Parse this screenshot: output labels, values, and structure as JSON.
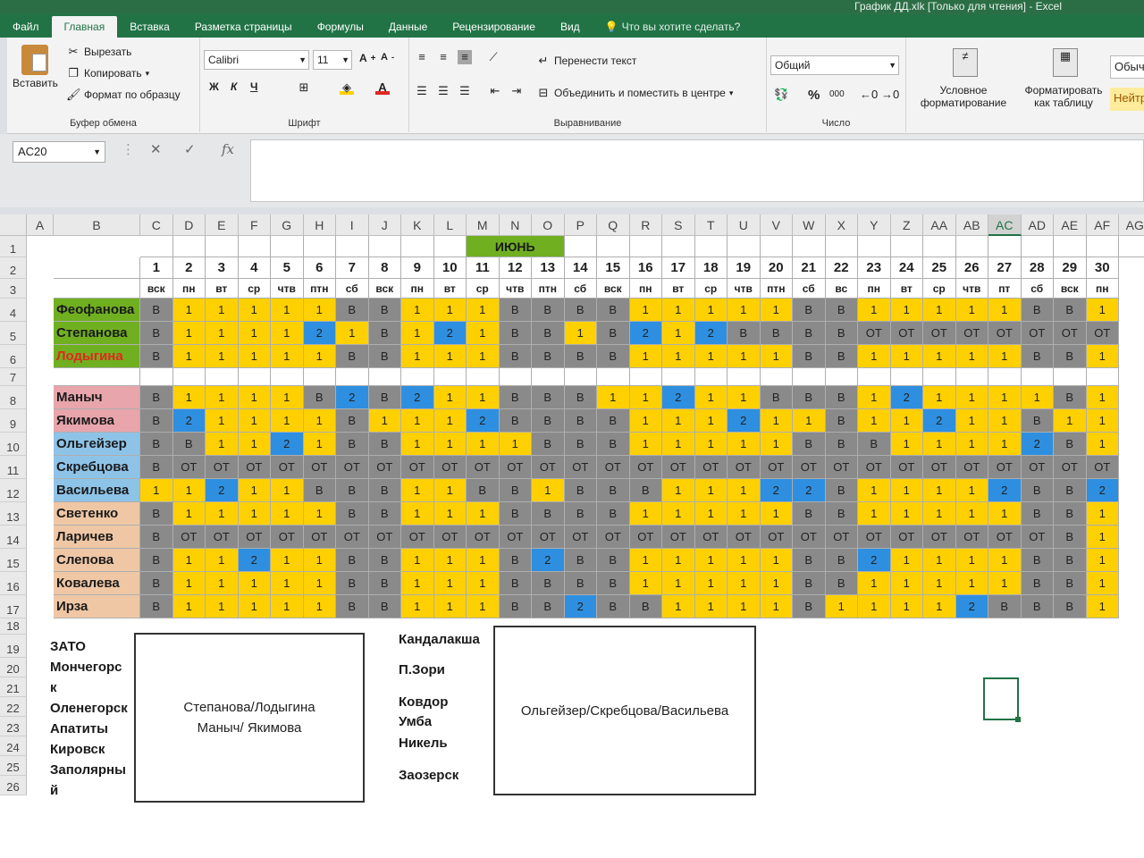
{
  "window": {
    "title": "График ДД.xlk  [Только для чтения] - Excel"
  },
  "tabs": [
    "Файл",
    "Главная",
    "Вставка",
    "Разметка страницы",
    "Формулы",
    "Данные",
    "Рецензирование",
    "Вид"
  ],
  "active_tab": "Главная",
  "tell_me": "Что вы хотите сделать?",
  "ribbon": {
    "clipboard": {
      "paste": "Вставить",
      "cut": "Вырезать",
      "copy": "Копировать",
      "format_painter": "Формат по образцу",
      "label": "Буфер обмена"
    },
    "font": {
      "name": "Calibri",
      "size": "11",
      "bold": "Ж",
      "italic": "К",
      "underline": "Ч",
      "label": "Шрифт"
    },
    "alignment": {
      "wrap": "Перенести текст",
      "merge": "Объединить и поместить в центре",
      "label": "Выравнивание"
    },
    "number": {
      "format": "Общий",
      "percent": "%",
      "thousands": "000",
      "label": "Число"
    },
    "styles": {
      "conditional": "Условное форматирование",
      "as_table": "Форматировать как таблицу",
      "normal": "Обыч",
      "neutral": "Нейтр"
    }
  },
  "name_box": "AC20",
  "formula": "",
  "colors": {
    "yellow": "#ffd000",
    "gray": "#8a8a8a",
    "blue": "#2e8fe0",
    "orange": "#f0a020",
    "green": "#70b020",
    "pink": "#e8a5ab",
    "lightblue": "#8ec3e8",
    "peach": "#efc7a5",
    "excel_green": "#217346"
  },
  "columns": [
    "A",
    "B",
    "C",
    "D",
    "E",
    "F",
    "G",
    "H",
    "I",
    "J",
    "K",
    "L",
    "M",
    "N",
    "O",
    "P",
    "Q",
    "R",
    "S",
    "T",
    "U",
    "V",
    "W",
    "X",
    "Y",
    "Z",
    "AA",
    "AB",
    "AC",
    "AD",
    "AE",
    "AF",
    "AG"
  ],
  "selected_column": "AC",
  "rows": [
    "1",
    "2",
    "3",
    "4",
    "5",
    "6",
    "7",
    "8",
    "9",
    "10",
    "11",
    "12",
    "13",
    "14",
    "15",
    "16",
    "17",
    "18",
    "19",
    "20",
    "21",
    "22",
    "23",
    "24",
    "25",
    "26"
  ],
  "month": "ИЮНЬ",
  "days": [
    "1",
    "2",
    "3",
    "4",
    "5",
    "6",
    "7",
    "8",
    "9",
    "10",
    "11",
    "12",
    "13",
    "14",
    "15",
    "16",
    "17",
    "18",
    "19",
    "20",
    "21",
    "22",
    "23",
    "24",
    "25",
    "26",
    "27",
    "28",
    "29",
    "30"
  ],
  "weekdays": [
    "вск",
    "пн",
    "вт",
    "ср",
    "чтв",
    "птн",
    "сб",
    "вск",
    "пн",
    "вт",
    "ср",
    "чтв",
    "птн",
    "сб",
    "вск",
    "пн",
    "вт",
    "ср",
    "чтв",
    "птн",
    "сб",
    "вс",
    "пн",
    "вт",
    "ср",
    "чтв",
    "пт",
    "сб",
    "вск",
    "пн"
  ],
  "staff": [
    {
      "name": "Феофанова",
      "color": "green",
      "cells": [
        "В",
        "1",
        "1",
        "1",
        "1",
        "1",
        "В",
        "В",
        "1",
        "1",
        "1",
        "В",
        "В",
        "В",
        "В",
        "1",
        "1",
        "1",
        "1",
        "1",
        "В",
        "В",
        "1",
        "1",
        "1",
        "1",
        "1",
        "В",
        "В",
        "1"
      ]
    },
    {
      "name": "Степанова",
      "color": "green",
      "cells": [
        "В",
        "1",
        "1",
        "1",
        "1",
        "2",
        "1",
        "В",
        "1",
        "2",
        "1",
        "В",
        "В",
        "1",
        "В",
        "2",
        "1",
        "2",
        "В",
        "В",
        "В",
        "В",
        "ОТ",
        "ОТ",
        "ОТ",
        "ОТ",
        "ОТ",
        "ОТ",
        "ОТ",
        "ОТ"
      ]
    },
    {
      "name": "Лодыгина",
      "color": "green",
      "name_color": "#e0281e",
      "cells": [
        "В",
        "1",
        "1",
        "1",
        "1",
        "1",
        "В",
        "В",
        "1",
        "1",
        "1",
        "В",
        "В",
        "В",
        "В",
        "1",
        "1",
        "1",
        "1",
        "1",
        "В",
        "В",
        "1",
        "1",
        "1",
        "1",
        "1",
        "В",
        "В",
        "1"
      ]
    },
    {
      "name": "",
      "color": "white",
      "cells": [
        "",
        "",
        "",
        "",
        "",
        "",
        "",
        "",
        "",
        "",
        "",
        "",
        "",
        "",
        "",
        "",
        "",
        "",
        "",
        "",
        "",
        "",
        "",
        "",
        "",
        "",
        "",
        "",
        "",
        ""
      ]
    },
    {
      "name": "Маныч",
      "color": "pink",
      "cells": [
        "В",
        "1",
        "1",
        "1",
        "1",
        "В",
        "2",
        "В",
        "2",
        "1",
        "1",
        "В",
        "В",
        "В",
        "1",
        "1",
        "2",
        "1",
        "1",
        "В",
        "В",
        "В",
        "1",
        "2",
        "1",
        "1",
        "1",
        "1",
        "В",
        "1"
      ]
    },
    {
      "name": "Якимова",
      "color": "pink",
      "cells": [
        "В",
        "2",
        "1",
        "1",
        "1",
        "1",
        "В",
        "1",
        "1",
        "1",
        "2",
        "В",
        "В",
        "В",
        "В",
        "1",
        "1",
        "1",
        "2",
        "1",
        "1",
        "В",
        "1",
        "1",
        "2",
        "1",
        "1",
        "В",
        "1",
        "1"
      ]
    },
    {
      "name": "Ольгейзер",
      "color": "lightblue",
      "cells": [
        "В",
        "В",
        "1",
        "1",
        "2",
        "1",
        "В",
        "В",
        "1",
        "1",
        "1",
        "1",
        "В",
        "В",
        "В",
        "1",
        "1",
        "1",
        "1",
        "1",
        "В",
        "В",
        "В",
        "1",
        "1",
        "1",
        "1",
        "2",
        "В",
        "1"
      ]
    },
    {
      "name": "Скребцова",
      "color": "lightblue",
      "cells": [
        "В",
        "ОТ",
        "ОТ",
        "ОТ",
        "ОТ",
        "ОТ",
        "ОТ",
        "ОТ",
        "ОТ",
        "ОТ",
        "ОТ",
        "ОТ",
        "ОТ",
        "ОТ",
        "ОТ",
        "ОТ",
        "ОТ",
        "ОТ",
        "ОТ",
        "ОТ",
        "ОТ",
        "ОТ",
        "ОТ",
        "ОТ",
        "ОТ",
        "ОТ",
        "ОТ",
        "ОТ",
        "ОТ",
        "ОТ"
      ]
    },
    {
      "name": "Васильева",
      "color": "lightblue",
      "cells": [
        "1",
        "1",
        "2",
        "1",
        "1",
        "В",
        "В",
        "В",
        "1",
        "1",
        "В",
        "В",
        "1",
        "В",
        "В",
        "В",
        "1",
        "1",
        "1",
        "2",
        "2",
        "В",
        "1",
        "1",
        "1",
        "1",
        "2",
        "В",
        "В",
        "2"
      ]
    },
    {
      "name": "Светенко",
      "color": "peach",
      "cells": [
        "В",
        "1",
        "1",
        "1",
        "1",
        "1",
        "В",
        "В",
        "1",
        "1",
        "1",
        "В",
        "В",
        "В",
        "В",
        "1",
        "1",
        "1",
        "1",
        "1",
        "В",
        "В",
        "1",
        "1",
        "1",
        "1",
        "1",
        "В",
        "В",
        "1"
      ]
    },
    {
      "name": "Ларичев",
      "color": "peach",
      "cells": [
        "В",
        "ОТ",
        "ОТ",
        "ОТ",
        "ОТ",
        "ОТ",
        "ОТ",
        "ОТ",
        "ОТ",
        "ОТ",
        "ОТ",
        "ОТ",
        "ОТ",
        "ОТ",
        "ОТ",
        "ОТ",
        "ОТ",
        "ОТ",
        "ОТ",
        "ОТ",
        "ОТ",
        "ОТ",
        "ОТ",
        "ОТ",
        "ОТ",
        "ОТ",
        "ОТ",
        "ОТ",
        "В",
        "1"
      ]
    },
    {
      "name": "Слепова",
      "color": "peach",
      "cells": [
        "В",
        "1",
        "1",
        "2",
        "1",
        "1",
        "В",
        "В",
        "1",
        "1",
        "1",
        "В",
        "2",
        "В",
        "В",
        "1",
        "1",
        "1",
        "1",
        "1",
        "В",
        "В",
        "2",
        "1",
        "1",
        "1",
        "1",
        "В",
        "В",
        "1"
      ]
    },
    {
      "name": "Ковалева",
      "color": "peach",
      "cells": [
        "В",
        "1",
        "1",
        "1",
        "1",
        "1",
        "В",
        "В",
        "1",
        "1",
        "1",
        "В",
        "В",
        "В",
        "В",
        "1",
        "1",
        "1",
        "1",
        "1",
        "В",
        "В",
        "1",
        "1",
        "1",
        "1",
        "1",
        "В",
        "В",
        "1"
      ]
    },
    {
      "name": "Ирза",
      "color": "peach",
      "cells": [
        "В",
        "1",
        "1",
        "1",
        "1",
        "1",
        "В",
        "В",
        "1",
        "1",
        "1",
        "В",
        "В",
        "2",
        "В",
        "В",
        "1",
        "1",
        "1",
        "1",
        "В",
        "1",
        "1",
        "1",
        "1",
        "2",
        "В",
        "В",
        "В",
        "1"
      ]
    }
  ],
  "notes": {
    "left_list": [
      "ЗАТО",
      "Мончегорс",
      "к",
      "Оленегорск",
      "Апатиты",
      "Кировск",
      "Заполярны",
      "й"
    ],
    "left_box": [
      "Степанова/Лодыгина",
      "Маныч/ Якимова"
    ],
    "right_list": [
      "Кандалакша",
      "П.Зори",
      "Ковдор",
      "Умба",
      "Никель",
      "Заозерск"
    ],
    "right_box": "Ольгейзер/Скребцова/Васильева"
  }
}
